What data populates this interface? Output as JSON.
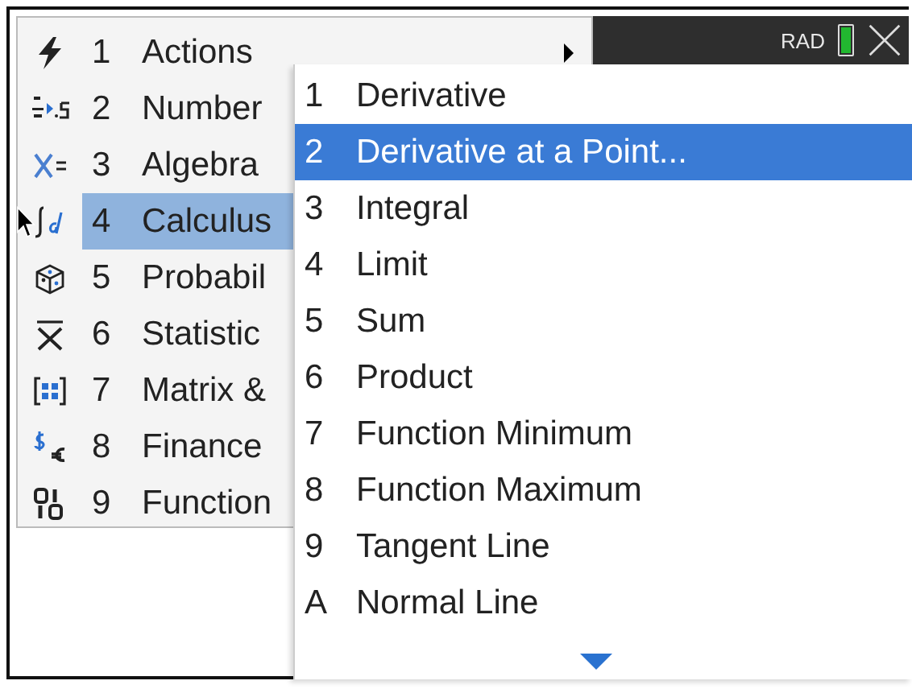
{
  "status": {
    "mode": "RAD"
  },
  "menu": {
    "items": [
      {
        "number": "1",
        "label": "Actions",
        "kind": "lightning",
        "has_submenu": true,
        "selected": false
      },
      {
        "number": "2",
        "label": "Number",
        "kind": "fraction",
        "selected": false
      },
      {
        "number": "3",
        "label": "Algebra",
        "kind": "equation",
        "selected": false
      },
      {
        "number": "4",
        "label": "Calculus",
        "kind": "integral",
        "selected": true
      },
      {
        "number": "5",
        "label": "Probabil",
        "kind": "dice",
        "selected": false
      },
      {
        "number": "6",
        "label": "Statistic",
        "kind": "mean",
        "selected": false
      },
      {
        "number": "7",
        "label": "Matrix &",
        "kind": "matrix",
        "selected": false
      },
      {
        "number": "8",
        "label": "Finance",
        "kind": "money",
        "selected": false
      },
      {
        "number": "9",
        "label": "Function",
        "kind": "binary",
        "selected": false
      }
    ]
  },
  "submenu": {
    "more_below": true,
    "items": [
      {
        "number": "1",
        "label": "Derivative",
        "selected": false
      },
      {
        "number": "2",
        "label": "Derivative at a Point...",
        "selected": true
      },
      {
        "number": "3",
        "label": "Integral",
        "selected": false
      },
      {
        "number": "4",
        "label": "Limit",
        "selected": false
      },
      {
        "number": "5",
        "label": "Sum",
        "selected": false
      },
      {
        "number": "6",
        "label": "Product",
        "selected": false
      },
      {
        "number": "7",
        "label": "Function Minimum",
        "selected": false
      },
      {
        "number": "8",
        "label": "Function Maximum",
        "selected": false
      },
      {
        "number": "9",
        "label": "Tangent Line",
        "selected": false
      },
      {
        "number": "A",
        "label": "Normal Line",
        "selected": false
      }
    ]
  }
}
